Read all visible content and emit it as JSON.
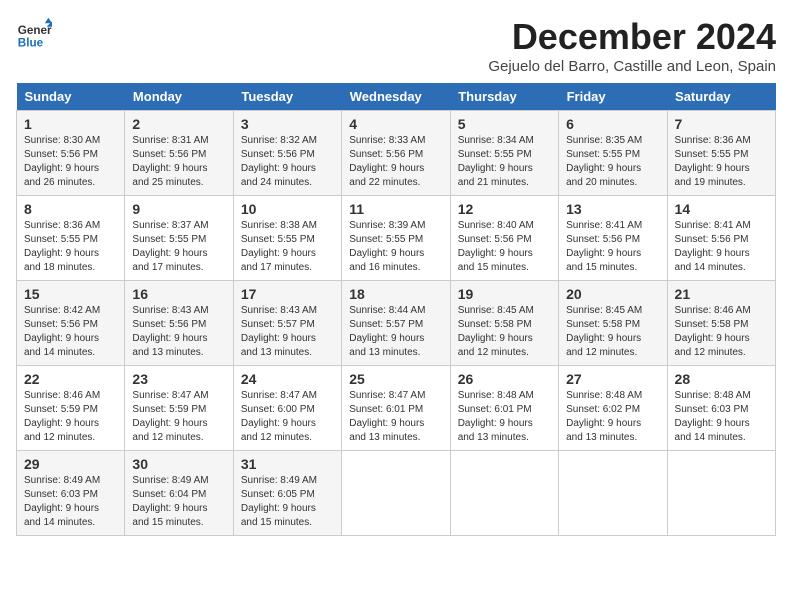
{
  "header": {
    "logo_line1": "General",
    "logo_line2": "Blue",
    "month_title": "December 2024",
    "location": "Gejuelo del Barro, Castille and Leon, Spain"
  },
  "columns": [
    "Sunday",
    "Monday",
    "Tuesday",
    "Wednesday",
    "Thursday",
    "Friday",
    "Saturday"
  ],
  "weeks": [
    [
      {
        "day": "1",
        "info": "Sunrise: 8:30 AM\nSunset: 5:56 PM\nDaylight: 9 hours and 26 minutes."
      },
      {
        "day": "2",
        "info": "Sunrise: 8:31 AM\nSunset: 5:56 PM\nDaylight: 9 hours and 25 minutes."
      },
      {
        "day": "3",
        "info": "Sunrise: 8:32 AM\nSunset: 5:56 PM\nDaylight: 9 hours and 24 minutes."
      },
      {
        "day": "4",
        "info": "Sunrise: 8:33 AM\nSunset: 5:56 PM\nDaylight: 9 hours and 22 minutes."
      },
      {
        "day": "5",
        "info": "Sunrise: 8:34 AM\nSunset: 5:55 PM\nDaylight: 9 hours and 21 minutes."
      },
      {
        "day": "6",
        "info": "Sunrise: 8:35 AM\nSunset: 5:55 PM\nDaylight: 9 hours and 20 minutes."
      },
      {
        "day": "7",
        "info": "Sunrise: 8:36 AM\nSunset: 5:55 PM\nDaylight: 9 hours and 19 minutes."
      }
    ],
    [
      {
        "day": "8",
        "info": "Sunrise: 8:36 AM\nSunset: 5:55 PM\nDaylight: 9 hours and 18 minutes."
      },
      {
        "day": "9",
        "info": "Sunrise: 8:37 AM\nSunset: 5:55 PM\nDaylight: 9 hours and 17 minutes."
      },
      {
        "day": "10",
        "info": "Sunrise: 8:38 AM\nSunset: 5:55 PM\nDaylight: 9 hours and 17 minutes."
      },
      {
        "day": "11",
        "info": "Sunrise: 8:39 AM\nSunset: 5:55 PM\nDaylight: 9 hours and 16 minutes."
      },
      {
        "day": "12",
        "info": "Sunrise: 8:40 AM\nSunset: 5:56 PM\nDaylight: 9 hours and 15 minutes."
      },
      {
        "day": "13",
        "info": "Sunrise: 8:41 AM\nSunset: 5:56 PM\nDaylight: 9 hours and 15 minutes."
      },
      {
        "day": "14",
        "info": "Sunrise: 8:41 AM\nSunset: 5:56 PM\nDaylight: 9 hours and 14 minutes."
      }
    ],
    [
      {
        "day": "15",
        "info": "Sunrise: 8:42 AM\nSunset: 5:56 PM\nDaylight: 9 hours and 14 minutes."
      },
      {
        "day": "16",
        "info": "Sunrise: 8:43 AM\nSunset: 5:56 PM\nDaylight: 9 hours and 13 minutes."
      },
      {
        "day": "17",
        "info": "Sunrise: 8:43 AM\nSunset: 5:57 PM\nDaylight: 9 hours and 13 minutes."
      },
      {
        "day": "18",
        "info": "Sunrise: 8:44 AM\nSunset: 5:57 PM\nDaylight: 9 hours and 13 minutes."
      },
      {
        "day": "19",
        "info": "Sunrise: 8:45 AM\nSunset: 5:58 PM\nDaylight: 9 hours and 12 minutes."
      },
      {
        "day": "20",
        "info": "Sunrise: 8:45 AM\nSunset: 5:58 PM\nDaylight: 9 hours and 12 minutes."
      },
      {
        "day": "21",
        "info": "Sunrise: 8:46 AM\nSunset: 5:58 PM\nDaylight: 9 hours and 12 minutes."
      }
    ],
    [
      {
        "day": "22",
        "info": "Sunrise: 8:46 AM\nSunset: 5:59 PM\nDaylight: 9 hours and 12 minutes."
      },
      {
        "day": "23",
        "info": "Sunrise: 8:47 AM\nSunset: 5:59 PM\nDaylight: 9 hours and 12 minutes."
      },
      {
        "day": "24",
        "info": "Sunrise: 8:47 AM\nSunset: 6:00 PM\nDaylight: 9 hours and 12 minutes."
      },
      {
        "day": "25",
        "info": "Sunrise: 8:47 AM\nSunset: 6:01 PM\nDaylight: 9 hours and 13 minutes."
      },
      {
        "day": "26",
        "info": "Sunrise: 8:48 AM\nSunset: 6:01 PM\nDaylight: 9 hours and 13 minutes."
      },
      {
        "day": "27",
        "info": "Sunrise: 8:48 AM\nSunset: 6:02 PM\nDaylight: 9 hours and 13 minutes."
      },
      {
        "day": "28",
        "info": "Sunrise: 8:48 AM\nSunset: 6:03 PM\nDaylight: 9 hours and 14 minutes."
      }
    ],
    [
      {
        "day": "29",
        "info": "Sunrise: 8:49 AM\nSunset: 6:03 PM\nDaylight: 9 hours and 14 minutes."
      },
      {
        "day": "30",
        "info": "Sunrise: 8:49 AM\nSunset: 6:04 PM\nDaylight: 9 hours and 15 minutes."
      },
      {
        "day": "31",
        "info": "Sunrise: 8:49 AM\nSunset: 6:05 PM\nDaylight: 9 hours and 15 minutes."
      },
      null,
      null,
      null,
      null
    ]
  ]
}
